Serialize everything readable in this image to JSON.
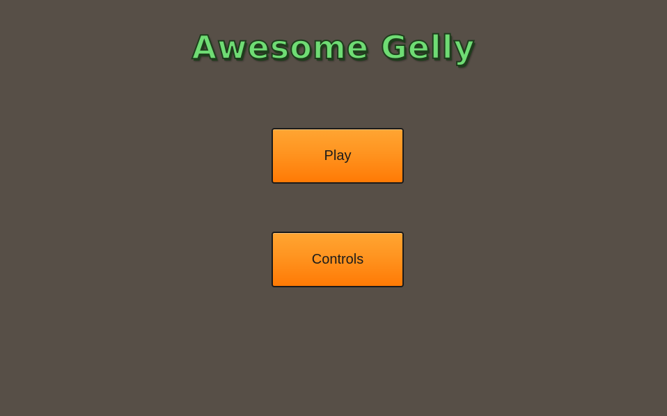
{
  "game": {
    "title": "Awesome Gelly"
  },
  "menu": {
    "play_label": "Play",
    "controls_label": "Controls"
  },
  "colors": {
    "background": "#574f47",
    "title_fill": "#6fdc74",
    "title_outline": "#1e3d1c",
    "button_top": "#ffa532",
    "button_bottom": "#ff7a05",
    "button_text": "#1b1b1b"
  }
}
